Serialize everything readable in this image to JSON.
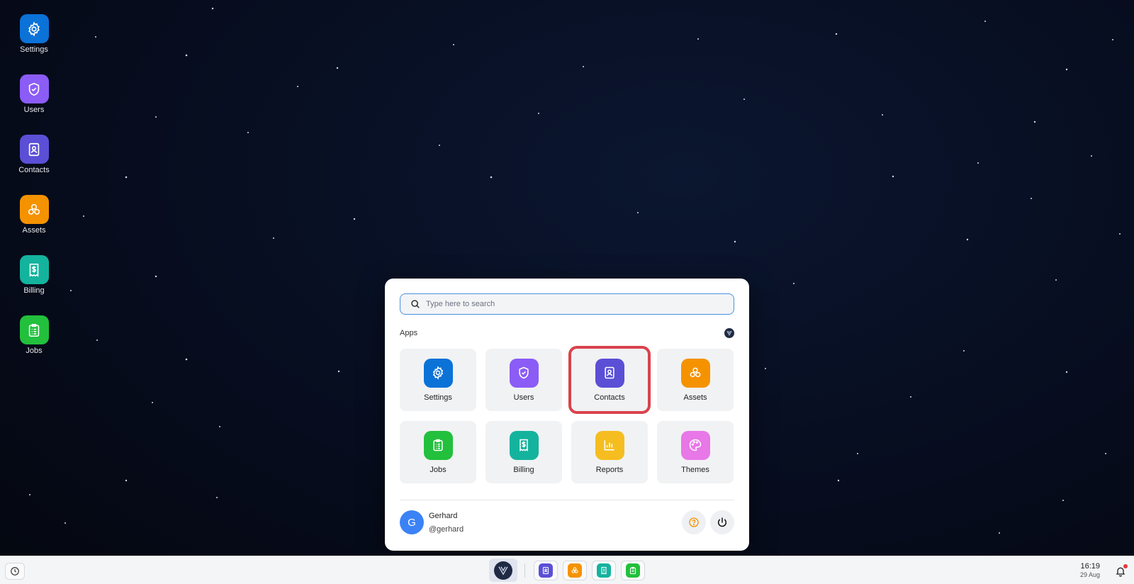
{
  "colors": {
    "settings": "#0b72d8",
    "users": "#8b5cf6",
    "contacts": "#5b4fd6",
    "assets": "#f59200",
    "billing": "#14b39e",
    "jobs": "#22c03c",
    "reports": "#f5bd1f",
    "themes": "#e877e8",
    "accent": "#4a90e2",
    "highlight": "#d9434c",
    "avatar": "#3b82f6"
  },
  "desktop": {
    "items": [
      {
        "label": "Settings",
        "icon": "gear-icon"
      },
      {
        "label": "Users",
        "icon": "shield-check-icon"
      },
      {
        "label": "Contacts",
        "icon": "contact-book-icon"
      },
      {
        "label": "Assets",
        "icon": "cubes-icon"
      },
      {
        "label": "Billing",
        "icon": "receipt-dollar-icon"
      },
      {
        "label": "Jobs",
        "icon": "clipboard-icon"
      }
    ]
  },
  "start_menu": {
    "search_placeholder": "Type here to search",
    "apps_title": "Apps",
    "apps": [
      {
        "label": "Settings",
        "icon": "gear-icon"
      },
      {
        "label": "Users",
        "icon": "shield-check-icon"
      },
      {
        "label": "Contacts",
        "icon": "contact-book-icon",
        "highlighted": true
      },
      {
        "label": "Assets",
        "icon": "cubes-icon"
      },
      {
        "label": "Jobs",
        "icon": "clipboard-icon"
      },
      {
        "label": "Billing",
        "icon": "receipt-dollar-icon"
      },
      {
        "label": "Reports",
        "icon": "bar-chart-icon"
      },
      {
        "label": "Themes",
        "icon": "palette-icon"
      }
    ],
    "user": {
      "initial": "G",
      "name": "Gerhard",
      "handle": "@gerhard"
    },
    "help_icon": "help-circle-icon",
    "power_icon": "power-icon"
  },
  "taskbar": {
    "history_icon": "clock-icon",
    "launcher_icon": "logo-icon",
    "pinned": [
      {
        "name": "contacts",
        "icon": "contact-book-icon"
      },
      {
        "name": "assets",
        "icon": "cubes-icon"
      },
      {
        "name": "billing",
        "icon": "receipt-dollar-icon"
      },
      {
        "name": "jobs",
        "icon": "clipboard-icon"
      }
    ],
    "time": "16:19",
    "date": "29 Aug",
    "notifications_icon": "bell-icon"
  }
}
